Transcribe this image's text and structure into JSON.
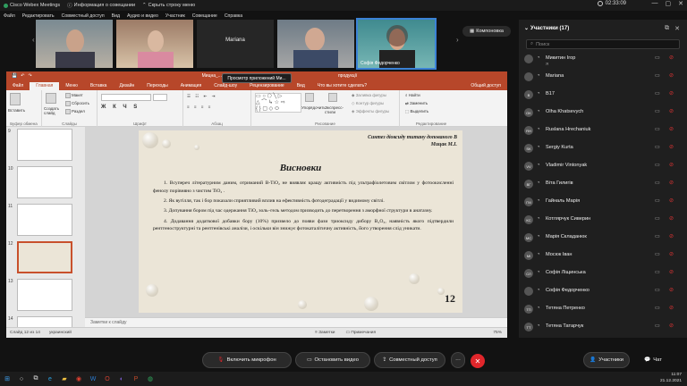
{
  "titlebar": {
    "app": "Cisco Webex Meetings",
    "info": "Информация о совещании",
    "hide": "Скрыть строку меню"
  },
  "menu": [
    "Файл",
    "Редактировать",
    "Совместный доступ",
    "Вид",
    "Аудио и видео",
    "Участник",
    "Совещание",
    "Справка"
  ],
  "timer": "02:33:09",
  "layout_button": "Компоновка",
  "video_tiles": [
    {
      "name": ""
    },
    {
      "name": ""
    },
    {
      "name": "Mariana"
    },
    {
      "name": ""
    },
    {
      "name": "Софія Федорченко"
    }
  ],
  "ppt": {
    "title": "Мицна_...",
    "title_right": "продукції",
    "tabs": [
      "Файл",
      "Главная",
      "Меню",
      "Вставка",
      "Дизайн",
      "Переходы",
      "Анимация",
      "Слайд-шоу",
      "Рецензирование",
      "Вид",
      "Что вы хотите сделать?",
      "Общий доступ"
    ],
    "selected_tab": "Главная",
    "ribbon": {
      "clipboard": "Буфер обмена",
      "slides": "Слайды",
      "font": "Шрифт",
      "paragraph": "Абзац",
      "drawing": "Рисование",
      "editing": "Редактирование",
      "paste": "Вставить",
      "new_slide": "Создать слайд",
      "layout": "Макет",
      "reset": "Сбросить",
      "section": "Раздел",
      "arrange": "Упорядочить",
      "quick_styles": "Экспресс-стили",
      "fill": "Заливка фигуры",
      "outline": "Контур фигуры",
      "effects": "Эффекты фигуры",
      "find": "Найти",
      "replace": "Заменить",
      "select": "Выделить"
    },
    "thumb_numbers": [
      "9",
      "10",
      "11",
      "12",
      "13",
      "14"
    ],
    "slide": {
      "author_line1": "Синтез діоксиду титану допованого B",
      "author_line2": "Мицак М.І.",
      "title": "Висновки",
      "p1": "1. Всупереч літературним даним, отриманий B-TiO₂ не виявляє кращу активність під ультрафіолетовим світлом у фотоокисленні фенолу порівняно з чистим TiO₂ .",
      "p2": "2. Як вугілля, так і бор показали сприятливий вплив на ефективність фотодеградації у видимому світлі.",
      "p3": "3. Допування бором під час одержання TiO₂ золь–гель методом призводить до перетворення з аморфної структури в анатазну.",
      "p4": "4. Додавання додаткової добавки бору (10%) призвело до появи фази триоксиду дибору B₂O₃, наявність якого підтвердили рентгеноструктурні та рентгенівські аналізи, і оскільки він знижує фотокаталітичну активність, його утворення слід уникати.",
      "number": "12"
    },
    "notes": "Заметки к слайду",
    "status": {
      "slide": "Слайд 12 из 14",
      "lang": "украинский",
      "notes": "Заметки",
      "comments": "Примечания",
      "zoom": "75%"
    }
  },
  "tooltip": "Просмотр приложений Ми...",
  "panel": {
    "title": "Участники (17)",
    "search_placeholder": "Поиск",
    "participants": [
      {
        "initials": "",
        "name": "Микитин Ігор",
        "sub": "Я"
      },
      {
        "initials": "",
        "name": "Mariana",
        "sub": ""
      },
      {
        "initials": "B",
        "name": "B17",
        "sub": ""
      },
      {
        "initials": "OK",
        "name": "Olha Khatsevych",
        "sub": ""
      },
      {
        "initials": "RH",
        "name": "Ruslana Hrechaniuk",
        "sub": ""
      },
      {
        "initials": "SK",
        "name": "Sergiy Kurta",
        "sub": ""
      },
      {
        "initials": "VV",
        "name": "Vladimir Vintonyak",
        "sub": ""
      },
      {
        "initials": "BГ",
        "name": "Віта Гилигів",
        "sub": ""
      },
      {
        "initials": "ГМ",
        "name": "Гайналь Марія",
        "sub": ""
      },
      {
        "initials": "КС",
        "name": "Котлярчук Сиверин",
        "sub": ""
      },
      {
        "initials": "МС",
        "name": "Марія Складанюк",
        "sub": ""
      },
      {
        "initials": "МІ",
        "name": "Мосюк Іван",
        "sub": ""
      },
      {
        "initials": "СЛ",
        "name": "Софія Ліщинська",
        "sub": ""
      },
      {
        "initials": "",
        "name": "Софія Федорченко",
        "sub": ""
      },
      {
        "initials": "ТП",
        "name": "Тетяна Петренко",
        "sub": ""
      },
      {
        "initials": "ТТ",
        "name": "Тетяна Татарчук",
        "sub": ""
      }
    ]
  },
  "controls": {
    "mic": "Включить микрофон",
    "video": "Остановить видео",
    "share": "Совместный доступ",
    "more": "···",
    "participants": "Участники",
    "chat": "Чат"
  },
  "clock": {
    "time": "11:07",
    "date": "21.12.2021",
    "lang": "УКР"
  }
}
